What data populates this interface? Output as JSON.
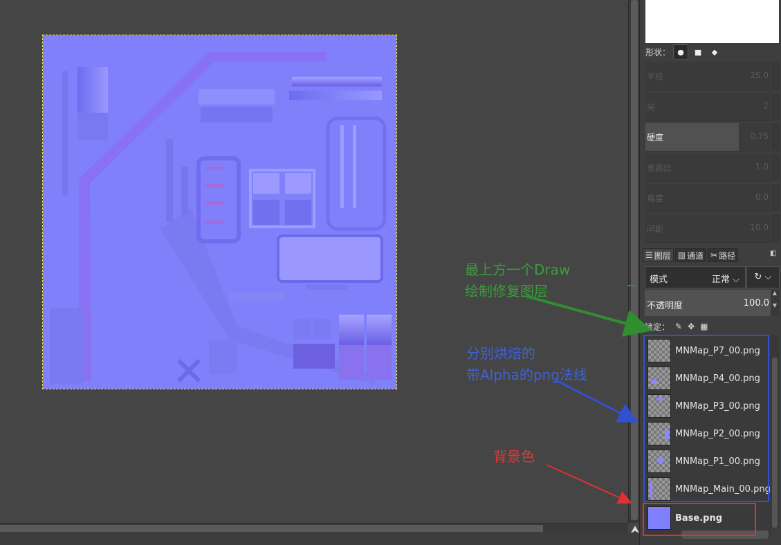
{
  "tool_options": {
    "shape_label": "形状：",
    "shapes": [
      "●",
      "■",
      "◆"
    ],
    "sliders": [
      {
        "label": "半径",
        "value": "25.0",
        "active": false
      },
      {
        "label": "尖",
        "value": "2",
        "active": false
      },
      {
        "label": "硬度",
        "value": "0.75",
        "active": true
      },
      {
        "label": "宽高比",
        "value": "1.0",
        "active": false
      },
      {
        "label": "角度",
        "value": "0.0",
        "active": false
      },
      {
        "label": "间距",
        "value": "10.0",
        "active": false
      }
    ]
  },
  "layers_panel": {
    "tabs": [
      {
        "icon": "layers-icon",
        "label": "图层"
      },
      {
        "icon": "channels-icon",
        "label": "通道"
      },
      {
        "icon": "paths-icon",
        "label": "路径"
      }
    ],
    "mode_label": "模式",
    "mode_value": "正常",
    "opacity_label": "不透明度",
    "opacity_value": "100.0",
    "lock_label": "锁定：",
    "layers": [
      {
        "name": "MNMap_P7_00.png",
        "bold": false
      },
      {
        "name": "MNMap_P4_00.png",
        "bold": false
      },
      {
        "name": "MNMap_P3_00.png",
        "bold": false
      },
      {
        "name": "MNMap_P2_00.png",
        "bold": false
      },
      {
        "name": "MNMap_P1_00.png",
        "bold": false
      },
      {
        "name": "MNMap_Main_00.png",
        "bold": false
      },
      {
        "name": "Base.png",
        "bold": true
      }
    ]
  },
  "annotations": {
    "green": [
      "最上方一个Draw",
      "绘制修复图层"
    ],
    "blue": [
      "分别烘焙的",
      "带Alpha的png法线"
    ],
    "red": [
      "背景色"
    ]
  },
  "colors": {
    "normal_map": "#8180fb",
    "annotation_green": "#3a9e3a",
    "annotation_blue": "#3f62d6",
    "annotation_red": "#e03838"
  }
}
